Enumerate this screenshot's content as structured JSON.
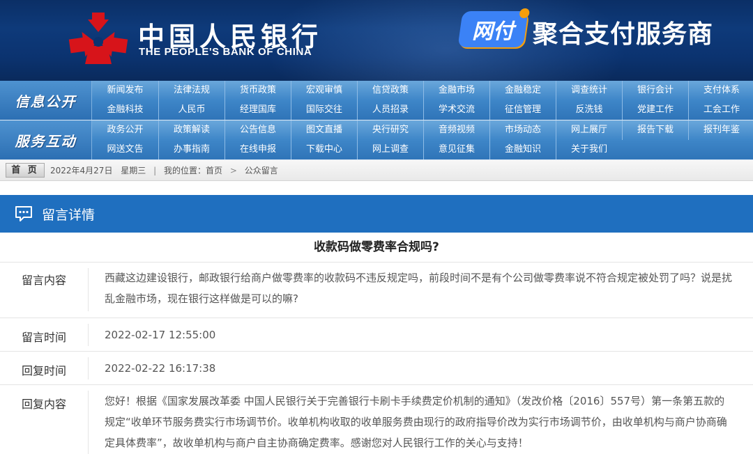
{
  "header": {
    "pboc_name_cn": "中国人民银行",
    "pboc_name_en": "THE PEOPLE'S BANK OF CHINA",
    "brand_badge": "网付",
    "brand_title": "聚合支付服务商"
  },
  "nav": {
    "section1_label": "信息公开",
    "section2_label": "服务互动",
    "section1_items": [
      "新闻发布",
      "法律法规",
      "货币政策",
      "宏观审慎",
      "信贷政策",
      "金融市场",
      "金融稳定",
      "调查统计",
      "银行会计",
      "支付体系",
      "金融科技",
      "人民币",
      "经理国库",
      "国际交往",
      "人员招录",
      "学术交流",
      "征信管理",
      "反洗钱",
      "党建工作",
      "工会工作"
    ],
    "section2_items": [
      "政务公开",
      "政策解读",
      "公告信息",
      "图文直播",
      "央行研究",
      "音频视频",
      "市场动态",
      "网上展厅",
      "报告下载",
      "报刊年鉴",
      "网送文告",
      "办事指南",
      "在线申报",
      "下载中心",
      "网上调查",
      "意见征集",
      "金融知识",
      "关于我们"
    ]
  },
  "breadcrumb": {
    "home": "首 页",
    "date": "2022年4月27日",
    "weekday": "星期三",
    "location_label": "我的位置：",
    "path_home": "首页",
    "path_current": "公众留言"
  },
  "detail": {
    "bar_title": "留言详情",
    "message_title": "收款码做零费率合规吗?",
    "content_label": "留言内容",
    "content_text": "西藏这边建设银行，邮政银行给商户做零费率的收款码不违反规定吗，前段时间不是有个公司做零费率说不符合规定被处罚了吗？说是扰乱金融市场，现在银行这样做是可以的嘛?",
    "time_label": "留言时间",
    "time_value": "2022-02-17 12:55:00",
    "reply_time_label": "回复时间",
    "reply_time_value": "2022-02-22 16:17:38",
    "reply_label": "回复内容",
    "reply_text": "您好！根据《国家发展改革委 中国人民银行关于完善银行卡刷卡手续费定价机制的通知》（发改价格〔2016〕557号）第一条第五款的规定“收单环节服务费实行市场调节价。收单机构收取的收单服务费由现行的政府指导价改为实行市场调节价，由收单机构与商户协商确定具体费率”，故收单机构与商户自主协商确定费率。感谢您对人民银行工作的关心与支持！"
  },
  "colors": {
    "header_bg": "#0b3370",
    "nav_blue": "#3e86c8",
    "detail_bar": "#1f6fbf",
    "pboc_red": "#d7141a"
  },
  "icons": {
    "logo": "pboc-emblem-icon",
    "detail": "chat-bubble-icon"
  }
}
